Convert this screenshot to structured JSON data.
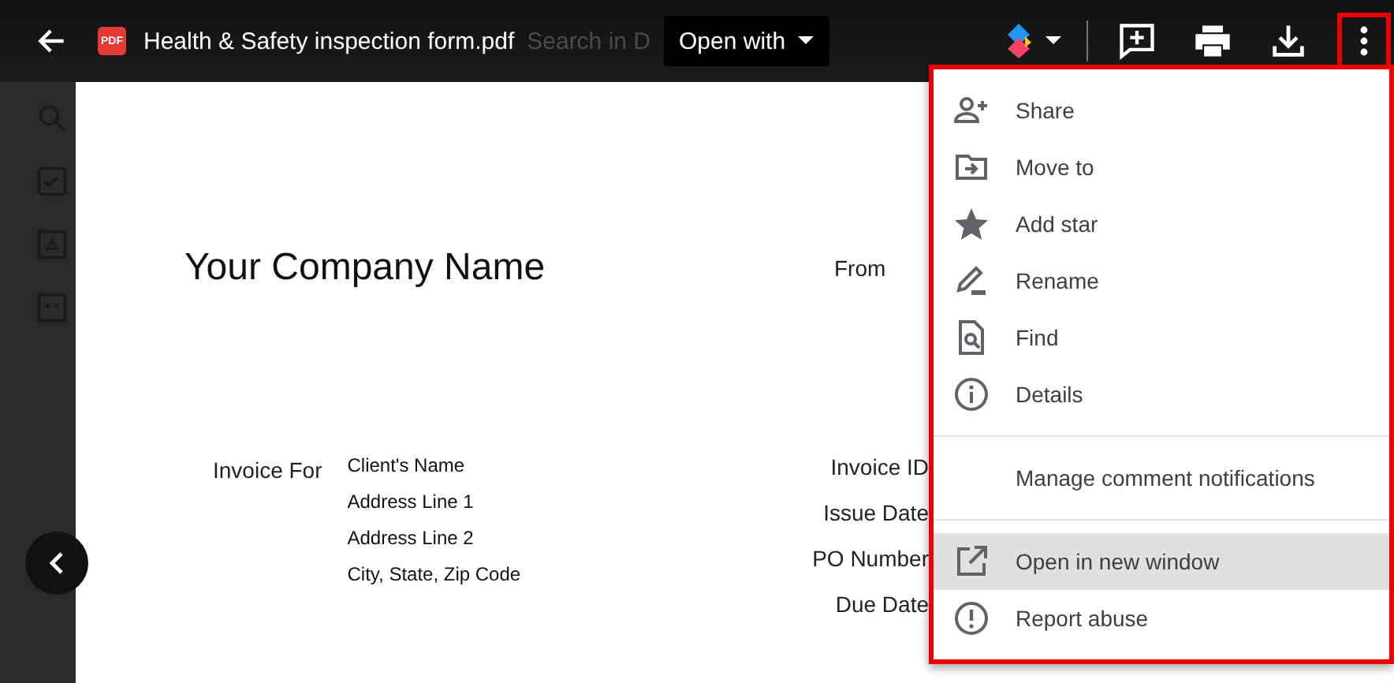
{
  "top_bar": {
    "file_badge": "PDF",
    "file_name": "Health & Safety inspection form.pdf",
    "background_search_hint": "Search in D",
    "open_with": "Open with",
    "more_highlighted": true
  },
  "document": {
    "company": "Your Company Name",
    "from_label": "From",
    "invoice_for_label": "Invoice For",
    "client_lines": [
      "Client's Name",
      "Address Line 1",
      "Address Line 2",
      "City, State, Zip Code"
    ],
    "right_labels": [
      "Invoice ID",
      "Issue Date",
      "PO Number",
      "Due Date"
    ]
  },
  "menu": {
    "highlighted": true,
    "groups": [
      [
        {
          "kind": "icon",
          "label": "Share",
          "selected": false
        },
        {
          "kind": "icon",
          "label": "Move to",
          "selected": false
        },
        {
          "kind": "icon",
          "label": "Add star",
          "selected": false
        },
        {
          "kind": "icon",
          "label": "Rename",
          "selected": false
        },
        {
          "kind": "icon",
          "label": "Find",
          "selected": false
        },
        {
          "kind": "icon",
          "label": "Details",
          "selected": false
        }
      ],
      [
        {
          "kind": "plain",
          "label": "Manage comment notifications",
          "selected": false
        }
      ],
      [
        {
          "kind": "icon",
          "label": "Open in new window",
          "selected": true
        },
        {
          "kind": "icon",
          "label": "Report abuse",
          "selected": false
        }
      ]
    ]
  }
}
